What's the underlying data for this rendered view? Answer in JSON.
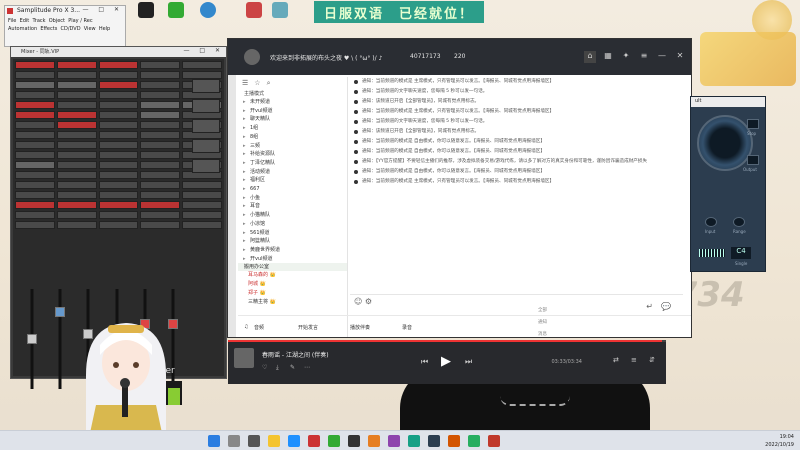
{
  "desktop": {
    "banner": "日服双语　已经就位！",
    "icons": [
      "",
      "",
      "",
      "",
      "",
      "",
      "",
      ""
    ],
    "big_digits": "1734"
  },
  "sample_window": {
    "title": "Samplitude Pro X 3...",
    "menu_row1": [
      "File",
      "Edit",
      "Track",
      "Object",
      "Play / Rec"
    ],
    "menu_row2": [
      "Automation",
      "Effects",
      "CD/DVD",
      "View",
      "Help"
    ]
  },
  "mixer": {
    "title": "Mixer - 同轨.VIP",
    "master_label": "master"
  },
  "yy": {
    "title": "欢迎来到非拓展的布头之夜 ♥ \\ ( °ω° )/ ♪",
    "channel_id": "40717173",
    "online_count": "220",
    "tree_header": "主播模式",
    "tree_items": [
      "未开频道",
      "开vul频道",
      "聊天精队",
      "1组",
      "8组",
      "三频",
      "补给资源队",
      "丁泽亿精队",
      "活动频道",
      "福利区",
      "667",
      "小鱼",
      "耳音",
      "小猫精队",
      "小凉馆",
      "561频道",
      "阿篮精队",
      "黄鹿世界频道",
      "开vul频道"
    ],
    "section_label": "搬用办公室",
    "users": [
      "耳马森的 👑",
      "阿城 👑",
      "郑子 👑",
      "三精主将 👑"
    ],
    "messages": [
      "通知：当前频道的模式是 主席模式，只有管理员可以发言。【海报员、同城有觉点用海报墙区】",
      "通知：当前频道的文字聊天速度，您每隔 5 秒可以发一句话。",
      "通知：该频道已开启【全部管理员】，同城有觉点用标志。",
      "通知：当前频道的模式是 主席模式，只有管理员可以发言。【海报员、同城有觉点用海报墙区】",
      "通知：当前频道的文字聊天速度，您每隔 5 秒可以发一句话。",
      "通知：该频道已开启【全部管理员】，同城有觉点用标志。",
      "通知：当前频道的模式是 自由模式，你可以随意发言。【海报员、同城有觉点用海报墙区】",
      "通知：当前频道的模式是 自由模式，你可以随意发言。【海报员、同城有觉点用海报墙区】",
      "通知：【YY官方提醒】不要轻信主播们的推荐，涉及虚拟装备交易/游戏代练，请以多了解对方的真实身份和可靠性，谨防因诈骗造成财产损失",
      "通知：当前频道的模式是 自由模式，你可以随意发言。【海报员、同城有觉点用海报墙区】",
      "通知：当前频道的模式是 主席模式，只有管理员可以发言。【海报员、同城有觉点用海报墙区】"
    ],
    "popup_items": [
      "全部",
      "通知",
      "消息",
      "转告"
    ],
    "bottom_items": [
      "音频",
      "开始发言",
      "播放伴奏",
      "录音"
    ]
  },
  "music": {
    "song": "春雨谣 - 江湖之间 (伴奏)",
    "time": "03:33/03:34",
    "progress": 0.99
  },
  "gauge": {
    "title": "ult",
    "readout": "C4",
    "labels": [
      "Stop",
      "Output",
      "Input",
      "Range",
      "Single"
    ]
  },
  "taskbar": {
    "time": "19:04",
    "date": "2022/10/19"
  },
  "colors": {
    "banner_bg": "#2c9e8a",
    "yy_header": "#2a2d33",
    "mixer_bg": "#2b2b2b"
  }
}
